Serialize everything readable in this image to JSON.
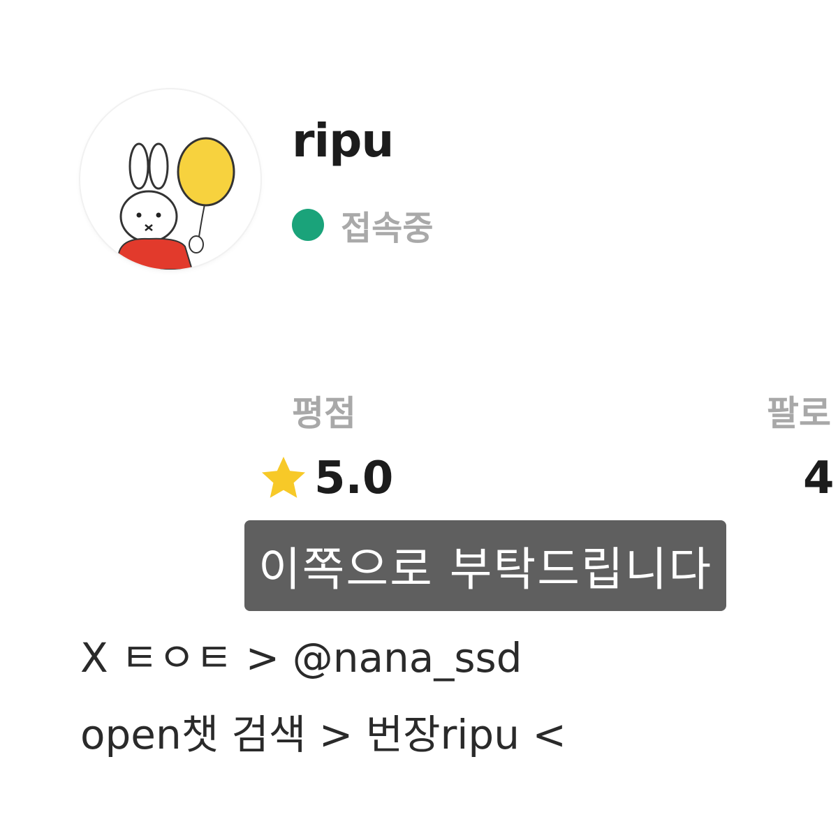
{
  "profile": {
    "username": "ripu",
    "status_text": "접속중",
    "status_color": "#1aa37a",
    "avatar_icon": "miffy-balloon-avatar-icon"
  },
  "stats": {
    "rating_label": "평점",
    "rating_value": "5.0",
    "rating_icon": "star-icon",
    "star_color": "#f7c928",
    "follow_label": "팔로",
    "follow_value": "4"
  },
  "sticker": {
    "text": "이쪽으로 부탁드립니다",
    "background": "#5f5f5f"
  },
  "description": {
    "line1": "X ㅌㅇㅌ > @nana_ssd",
    "line2": "open챗 검색 > 번장ripu <"
  }
}
